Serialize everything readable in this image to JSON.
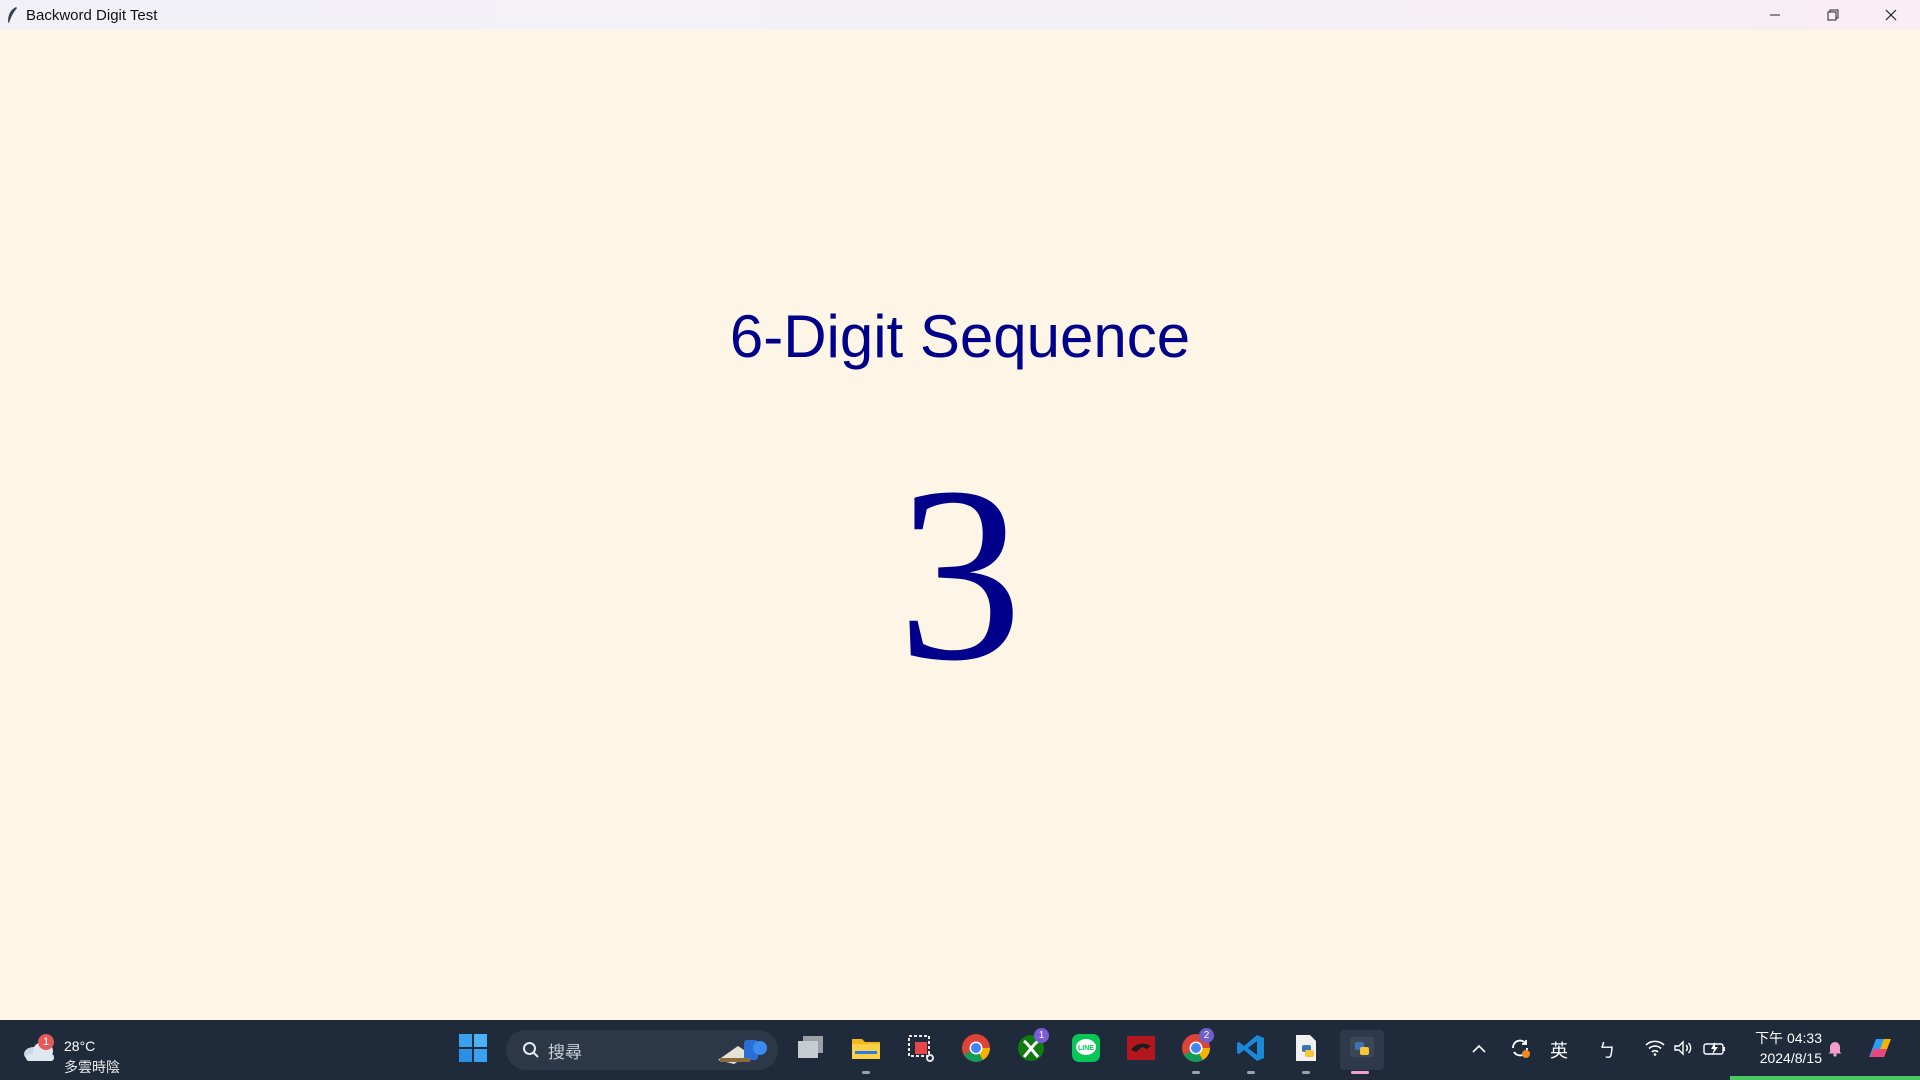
{
  "window": {
    "title": "Backword Digit Test"
  },
  "content": {
    "sequence_title": "6-Digit Sequence",
    "current_digit": "3"
  },
  "taskbar": {
    "weather": {
      "temperature": "28°C",
      "condition": "多雲時陰",
      "badge": "1"
    },
    "search_placeholder": "搜尋",
    "apps": [
      {
        "name": "start-button",
        "icon": "windows-logo"
      },
      {
        "name": "task-view",
        "icon": "task-view-icon"
      },
      {
        "name": "file-explorer",
        "icon": "folder-icon"
      },
      {
        "name": "snipping-tool",
        "icon": "snip-icon"
      },
      {
        "name": "chrome",
        "icon": "chrome-icon"
      },
      {
        "name": "xbox",
        "icon": "xbox-icon",
        "badge": "1"
      },
      {
        "name": "line",
        "icon": "line-icon",
        "label": "LINE"
      },
      {
        "name": "red-app",
        "icon": "red-app-icon"
      },
      {
        "name": "chrome-2",
        "icon": "chrome-icon",
        "badge": "2"
      },
      {
        "name": "vscode",
        "icon": "vscode-icon"
      },
      {
        "name": "python-file",
        "icon": "python-file-icon"
      },
      {
        "name": "python",
        "icon": "python-icon"
      }
    ],
    "tray": {
      "ime_language": "英",
      "ime_mode": "ㄅ",
      "time": "下午 04:33",
      "date": "2024/8/15"
    }
  },
  "colors": {
    "background": "#fdf5e6",
    "text_accent": "#00008b",
    "taskbar": "#1f2a3b"
  }
}
